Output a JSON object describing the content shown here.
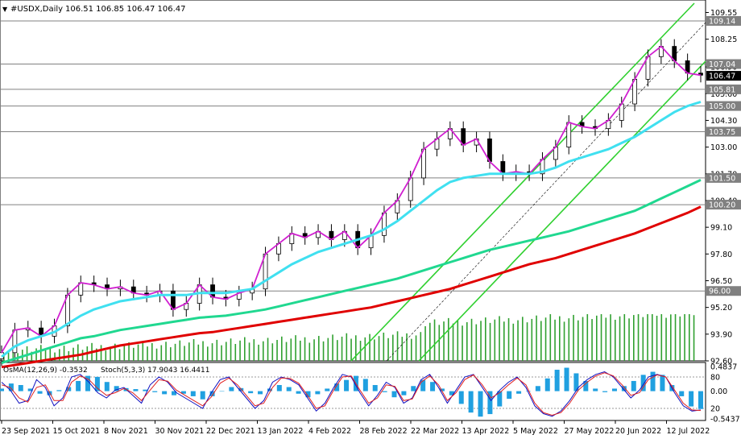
{
  "header": {
    "symbol": "#USDX,Daily",
    "ohlc": "106.51 106.85 106.47 106.47"
  },
  "oscillator_header": {
    "osma": "OsMA(12,26,9) -0.3532",
    "stoch": "Stoch(5,3,3) 17.9043 16.4411"
  },
  "colors": {
    "background": "#ffffff",
    "price_line": "#d020d0",
    "ma_cyan": "#40e0f0",
    "ma_green": "#20d890",
    "ma_red": "#e00000",
    "channel": "#30d030",
    "volume": "#30a030",
    "osma_hist": "#20a0e0",
    "stoch_main": "#1010c0",
    "stoch_signal": "#e02020"
  },
  "chart_data": [
    {
      "type": "line",
      "title": "#USDX,Daily",
      "x": [
        "23 Sep 2021",
        "15 Oct 2021",
        "8 Nov 2021",
        "30 Nov 2021",
        "22 Dec 2021",
        "13 Jan 2022",
        "4 Feb 2022",
        "28 Feb 2022",
        "22 Mar 2022",
        "13 Apr 2022",
        "5 May 2022",
        "27 May 2022",
        "20 Jun 2022",
        "12 Jul 2022"
      ],
      "ylim": [
        92.6,
        110.0
      ],
      "y_ticks": [
        92.6,
        93.9,
        95.2,
        96.5,
        97.8,
        99.1,
        100.4,
        101.7,
        103.0,
        104.3,
        105.6,
        106.9,
        108.25,
        109.55
      ],
      "level_labels": [
        "109.14",
        "107.04",
        "106.47",
        "105.81",
        "105.00",
        "103.75",
        "101.50",
        "100.20",
        "96.00"
      ],
      "levels": [
        109.14,
        107.04,
        105.81,
        105.0,
        103.75,
        101.5,
        100.2,
        96.0
      ],
      "current_price": 106.47,
      "grid": false,
      "series": [
        {
          "values": [
            93.0,
            94.1,
            94.2,
            93.8,
            94.3,
            95.8,
            96.4,
            96.3,
            96.1,
            96.2,
            95.9,
            95.8,
            96.0,
            95.1,
            95.4,
            96.3,
            95.7,
            95.6,
            95.9,
            96.1,
            97.8,
            98.3,
            98.8,
            98.6,
            98.9,
            98.5,
            98.9,
            98.1,
            98.7,
            99.8,
            100.4,
            101.5,
            102.9,
            103.4,
            103.9,
            103.1,
            103.4,
            102.3,
            101.7,
            101.8,
            101.7,
            102.4,
            103.0,
            104.2,
            104.0,
            103.9,
            104.3,
            105.1,
            106.3,
            107.4,
            107.9,
            107.2,
            106.6,
            106.5
          ]
        },
        {
          "values": [
            92.8,
            93.3,
            93.6,
            93.8,
            94.0,
            94.4,
            94.8,
            95.1,
            95.3,
            95.5,
            95.6,
            95.7,
            95.8,
            95.8,
            95.8,
            95.9,
            95.9,
            95.9,
            96.0,
            96.1,
            96.5,
            96.9,
            97.3,
            97.6,
            97.9,
            98.1,
            98.3,
            98.5,
            98.7,
            99.0,
            99.4,
            99.9,
            100.4,
            100.9,
            101.3,
            101.5,
            101.6,
            101.7,
            101.7,
            101.7,
            101.7,
            101.8,
            102.0,
            102.3,
            102.5,
            102.7,
            102.9,
            103.2,
            103.5,
            103.9,
            104.3,
            104.7,
            105.0,
            105.2
          ]
        },
        {
          "values": [
            92.5,
            92.7,
            92.9,
            93.1,
            93.3,
            93.5,
            93.7,
            93.8,
            93.95,
            94.1,
            94.2,
            94.3,
            94.4,
            94.5,
            94.6,
            94.7,
            94.75,
            94.8,
            94.9,
            95.0,
            95.1,
            95.25,
            95.4,
            95.55,
            95.7,
            95.85,
            96.0,
            96.15,
            96.3,
            96.45,
            96.6,
            96.8,
            97.0,
            97.2,
            97.4,
            97.6,
            97.8,
            98.0,
            98.15,
            98.3,
            98.45,
            98.6,
            98.75,
            98.9,
            99.1,
            99.3,
            99.5,
            99.7,
            99.9,
            100.2,
            100.5,
            100.8,
            101.1,
            101.4
          ]
        },
        {
          "values": [
            92.3,
            92.4,
            92.5,
            92.6,
            92.7,
            92.8,
            92.9,
            93.05,
            93.2,
            93.35,
            93.45,
            93.55,
            93.65,
            93.75,
            93.85,
            93.95,
            94.0,
            94.1,
            94.2,
            94.3,
            94.4,
            94.5,
            94.6,
            94.7,
            94.8,
            94.9,
            95.0,
            95.1,
            95.2,
            95.35,
            95.5,
            95.65,
            95.8,
            95.95,
            96.1,
            96.3,
            96.5,
            96.7,
            96.9,
            97.1,
            97.3,
            97.45,
            97.6,
            97.8,
            98.0,
            98.2,
            98.4,
            98.6,
            98.8,
            99.05,
            99.3,
            99.55,
            99.8,
            100.1
          ]
        }
      ]
    },
    {
      "type": "bar",
      "title": "OsMA(12,26,9) -0.3532 / Stoch(5,3,3) 17.9043 16.4411",
      "ylim": [
        -0.5437,
        0.4837
      ],
      "y_ticks": [
        "0.4837",
        "80",
        "0.00",
        "20",
        "-0.5437"
      ],
      "series": [
        {
          "values": [
            0.05,
            0.15,
            0.12,
            0.05,
            -0.05,
            -0.08,
            0.02,
            0.08,
            0.2,
            0.3,
            0.28,
            0.18,
            0.1,
            0.06,
            0.04,
            0.03,
            -0.02,
            -0.06,
            -0.08,
            -0.05,
            -0.1,
            -0.16,
            -0.1,
            0.0,
            0.08,
            0.06,
            -0.04,
            -0.06,
            0.05,
            0.12,
            0.08,
            -0.05,
            -0.12,
            -0.06,
            0.05,
            0.15,
            0.22,
            0.3,
            0.24,
            0.12,
            -0.02,
            -0.12,
            -0.08,
            0.1,
            0.22,
            0.18,
            0.05,
            -0.08,
            -0.25,
            -0.42,
            -0.5,
            -0.45,
            -0.3,
            -0.15,
            -0.05,
            0.0,
            0.1,
            0.25,
            0.42,
            0.46,
            0.35,
            0.2,
            0.05,
            -0.02,
            0.05,
            0.1,
            0.2,
            0.32,
            0.38,
            0.32,
            0.12,
            -0.1,
            -0.3,
            -0.35
          ]
        },
        {
          "values": [
            70,
            55,
            30,
            35,
            75,
            60,
            25,
            40,
            80,
            85,
            70,
            50,
            40,
            55,
            60,
            45,
            30,
            65,
            80,
            70,
            50,
            40,
            30,
            20,
            50,
            75,
            80,
            60,
            40,
            20,
            35,
            70,
            80,
            75,
            65,
            40,
            15,
            30,
            60,
            85,
            80,
            50,
            25,
            45,
            70,
            60,
            30,
            40,
            75,
            85,
            60,
            30,
            55,
            80,
            85,
            60,
            35,
            55,
            70,
            80,
            60,
            25,
            10,
            5,
            15,
            35,
            60,
            75,
            85,
            90,
            80,
            60,
            40,
            55,
            80,
            85,
            80,
            50,
            25,
            15,
            17
          ]
        },
        {
          "values": [
            65,
            60,
            40,
            32,
            60,
            65,
            35,
            35,
            70,
            82,
            75,
            58,
            45,
            50,
            58,
            50,
            35,
            55,
            75,
            72,
            55,
            45,
            35,
            25,
            42,
            68,
            78,
            65,
            45,
            25,
            30,
            60,
            78,
            77,
            68,
            45,
            20,
            25,
            55,
            80,
            82,
            55,
            30,
            40,
            65,
            62,
            35,
            38,
            70,
            82,
            65,
            35,
            50,
            75,
            84,
            65,
            40,
            50,
            65,
            78,
            65,
            30,
            12,
            7,
            12,
            30,
            55,
            70,
            82,
            88,
            82,
            65,
            45,
            50,
            75,
            84,
            80,
            55,
            30,
            17,
            16
          ]
        }
      ]
    }
  ],
  "x_axis_labels": [
    "23 Sep 2021",
    "15 Oct 2021",
    "8 Nov 2021",
    "30 Nov 2021",
    "22 Dec 2021",
    "13 Jan 2022",
    "4 Feb 2022",
    "28 Feb 2022",
    "22 Mar 2022",
    "13 Apr 2022",
    "5 May 2022",
    "27 May 2022",
    "20 Jun 2022",
    "12 Jul 2022"
  ],
  "level_labels": [
    "109.14",
    "107.04",
    "106.47",
    "105.81",
    "105.00",
    "103.75",
    "101.50",
    "100.20",
    "96.00"
  ],
  "y_tick_labels": [
    "109.55",
    "108.25",
    "106.90",
    "105.60",
    "104.30",
    "103.00",
    "101.70",
    "100.40",
    "99.10",
    "97.80",
    "96.50",
    "95.20",
    "93.90",
    "92.60"
  ],
  "osc_tick_labels": [
    "0.4837",
    "80",
    "0.00",
    "20",
    "-0.5437"
  ]
}
